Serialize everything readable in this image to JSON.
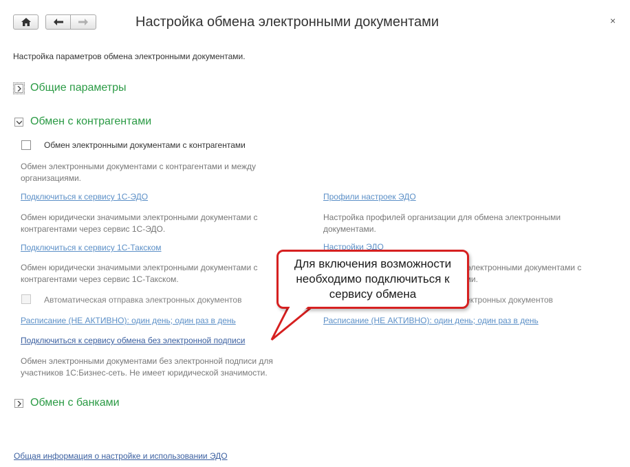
{
  "window": {
    "title": "Настройка обмена электронными документами",
    "close_glyph": "×"
  },
  "intro": "Настройка параметров обмена электронными документами.",
  "groups": {
    "general": {
      "title": "Общие параметры",
      "state": "collapsed"
    },
    "counterparties": {
      "title": "Обмен с контрагентами",
      "state": "expanded"
    },
    "banks": {
      "title": "Обмен с банками",
      "state": "collapsed"
    }
  },
  "counterparties": {
    "enable_checkbox": {
      "label": "Обмен электронными документами с контрагентами",
      "checked": false
    },
    "enable_desc": "Обмен электронными документами с контрагентами и между организациями.",
    "left": {
      "edo_link": "Подключиться к сервису 1С-ЭДО",
      "edo_desc": "Обмен юридически значимыми электронными документами с контрагентами через сервис 1С-ЭДО.",
      "taxcom_link": "Подключиться к сервису 1С-Такском",
      "taxcom_desc": "Обмен юридически значимыми электронными документами с контрагентами через сервис 1С-Такском.",
      "auto_send": {
        "label": "Автоматическая отправка электронных документов",
        "checked": false,
        "enabled": false
      },
      "schedule_link": "Расписание (НЕ АКТИВНО): один день; один раз в день",
      "no_signature_link": "Подключиться к сервису обмена без электронной подписи",
      "no_signature_desc": "Обмен электронными документами без электронной подписи для участников 1С:Бизнес-сеть. Не имеет юридической значимости."
    },
    "right": {
      "profiles_link": "Профили настроек ЭДО",
      "profiles_desc": "Настройка профилей организации для обмена электронными документами.",
      "settings_link": "Настройки ЭДО",
      "settings_desc_line1": "...ые электронными документами с",
      "settings_desc_line2": "...ами.",
      "auto_receive_label": "...лектронных документов",
      "schedule_link": "Расписание (НЕ АКТИВНО): один день; один раз в день"
    }
  },
  "callout": {
    "text": "Для включения возможности необходимо подключиться к сервису обмена",
    "border_color": "#d62020"
  },
  "footer": {
    "help_link": "Общая информация о настройке и использовании ЭДО"
  },
  "colors": {
    "group_title": "#2a9a44",
    "link": "#5b8fc7",
    "callout_border": "#d62020"
  }
}
